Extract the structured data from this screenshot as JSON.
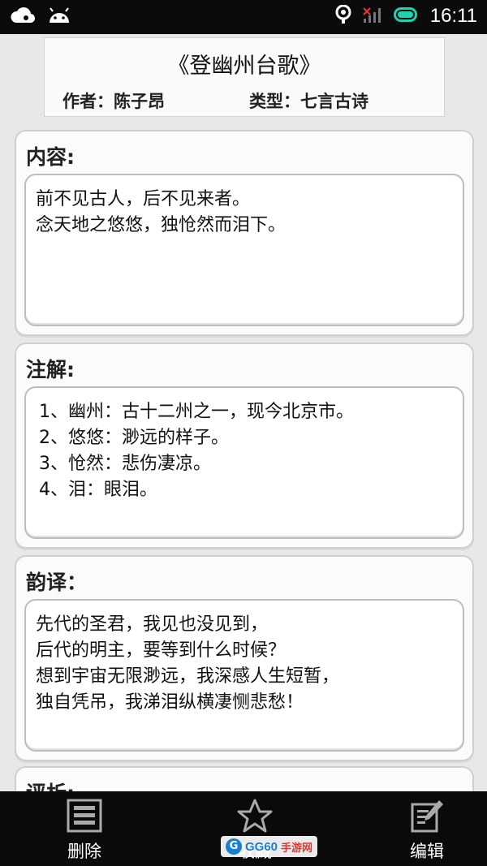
{
  "status_bar": {
    "time": "16:11"
  },
  "poem": {
    "title": "《登幽州台歌》",
    "author_label": "作者：",
    "author": "陈子昂",
    "type_label": "类型：",
    "type": "七言古诗"
  },
  "sections": {
    "content": {
      "title": "内容:",
      "lines": [
        "前不见古人，后不见来者。",
        "念天地之悠悠，独怆然而泪下。"
      ]
    },
    "notes": {
      "title": "注解:",
      "lines": [
        "1、幽州：古十二州之一，现今北京市。",
        "2、悠悠：渺远的样子。",
        "3、怆然：悲伤凄凉。",
        "4、泪：眼泪。"
      ]
    },
    "translation": {
      "title": "韵译：",
      "lines": [
        "先代的圣君，我见也没见到，",
        "后代的明主，要等到什么时候？",
        "想到宇宙无限渺远，我深感人生短暂，",
        "独自凭吊，我涕泪纵横凄恻悲愁！"
      ]
    },
    "analysis": {
      "title": "评析:"
    }
  },
  "bottom_bar": {
    "delete_label": "删除",
    "favorite_label": "收藏",
    "edit_label": "编辑"
  },
  "watermark": {
    "brand": "GG60",
    "suffix": "手游网"
  }
}
